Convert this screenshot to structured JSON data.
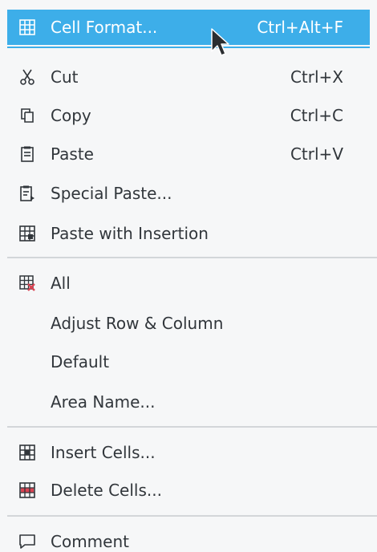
{
  "menu": {
    "items": [
      {
        "id": "cell-format",
        "label": "Cell Format...",
        "shortcut": "Ctrl+Alt+F",
        "icon": "table-icon",
        "highlighted": true
      },
      {
        "id": "cut",
        "label": "Cut",
        "shortcut": "Ctrl+X",
        "icon": "scissors-icon"
      },
      {
        "id": "copy",
        "label": "Copy",
        "shortcut": "Ctrl+C",
        "icon": "copy-icon"
      },
      {
        "id": "paste",
        "label": "Paste",
        "shortcut": "Ctrl+V",
        "icon": "paste-icon"
      },
      {
        "id": "special-paste",
        "label": "Special Paste...",
        "shortcut": "",
        "icon": "special-paste-icon"
      },
      {
        "id": "paste-with-insertion",
        "label": "Paste with Insertion",
        "shortcut": "",
        "icon": "paste-insert-icon"
      },
      {
        "id": "all",
        "label": "All",
        "shortcut": "",
        "icon": "clear-all-icon"
      },
      {
        "id": "adjust-row-column",
        "label": "Adjust Row & Column",
        "shortcut": "",
        "icon": ""
      },
      {
        "id": "default",
        "label": "Default",
        "shortcut": "",
        "icon": ""
      },
      {
        "id": "area-name",
        "label": "Area Name...",
        "shortcut": "",
        "icon": ""
      },
      {
        "id": "insert-cells",
        "label": "Insert Cells...",
        "shortcut": "",
        "icon": "insert-cells-icon"
      },
      {
        "id": "delete-cells",
        "label": "Delete Cells...",
        "shortcut": "",
        "icon": "delete-cells-icon"
      },
      {
        "id": "comment",
        "label": "Comment",
        "shortcut": "",
        "icon": "comment-icon"
      }
    ]
  },
  "colors": {
    "highlight": "#3daee9",
    "text": "#31363b",
    "icon": "#31363b",
    "delete_accent": "#da4453"
  }
}
